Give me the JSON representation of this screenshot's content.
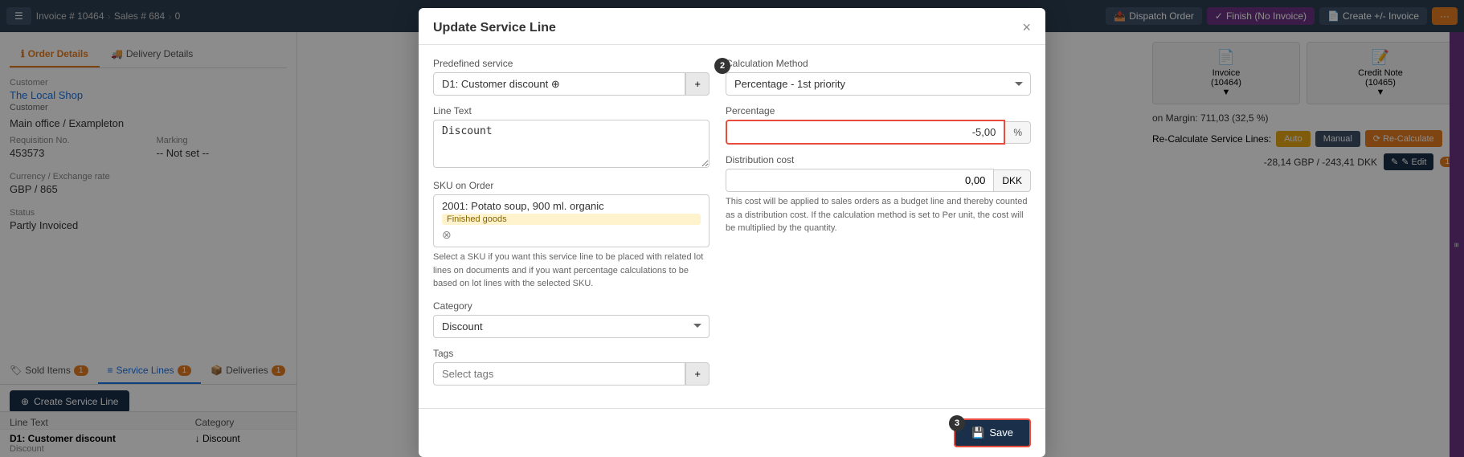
{
  "topnav": {
    "app_icon": "☰",
    "breadcrumbs": [
      {
        "label": "Invoice # 10464",
        "icon": "📄"
      },
      {
        "label": "Sales # 684",
        "icon": "📋"
      },
      {
        "label": "0",
        "icon": "🔗"
      }
    ],
    "buttons": [
      {
        "label": "Dispatch Order",
        "icon": "📤",
        "style": "dark"
      },
      {
        "label": "Finish (No Invoice)",
        "icon": "✓",
        "style": "purple"
      },
      {
        "label": "Create +/- Invoice",
        "icon": "📄",
        "style": "dark"
      },
      {
        "label": "...",
        "icon": "",
        "style": "orange"
      }
    ]
  },
  "left_panel": {
    "tabs": [
      {
        "label": "Order Details",
        "icon": "ℹ",
        "active": true
      },
      {
        "label": "Delivery Details",
        "icon": "🚚",
        "active": false
      }
    ],
    "customer_label": "Customer",
    "customer_name": "The Local Shop",
    "customer_type": "Customer",
    "address": "Main office / Exampleton",
    "fields": [
      {
        "label": "Requisition No.",
        "value": "453573"
      },
      {
        "label": "Marking",
        "value": "-- Not set --"
      },
      {
        "label": "Currency / Exchange rate",
        "value": "GBP / 865"
      },
      {
        "label": "Status",
        "value": "Partly Invoiced"
      }
    ],
    "bottom_tabs": [
      {
        "label": "Sold Items",
        "icon": "🏷",
        "badge": "1"
      },
      {
        "label": "Service Lines",
        "icon": "≡",
        "badge": "1",
        "active": true
      },
      {
        "label": "Deliveries",
        "icon": "📦",
        "badge": "1"
      }
    ],
    "create_btn": "Create Service Line",
    "table_headers": [
      "Line Text",
      "Category"
    ],
    "table_row": {
      "line_text": "D1: Customer discount",
      "sub_text": "Discount",
      "category_icon": "↓",
      "category": "Discount"
    }
  },
  "right_panel": {
    "doc_cards": [
      {
        "icon": "📄",
        "label": "Invoice",
        "sub": "(10464)",
        "arrow": "▼"
      },
      {
        "icon": "📝",
        "label": "Credit Note",
        "sub": "(10465)",
        "arrow": "▼"
      }
    ],
    "margin_text": "on Margin: 711,03 (32,5 %)",
    "recalc_label": "Re-Calculate Service Lines:",
    "recalc_btns": [
      {
        "label": "Auto",
        "style": "gold"
      },
      {
        "label": "Manual",
        "style": "dark"
      },
      {
        "label": "⟳ Re-Calculate",
        "style": "orange"
      }
    ],
    "price_text": "-28,14 GBP / -243,41 DKK",
    "edit_btn": "✎ Edit",
    "badge_num": "1"
  },
  "modal": {
    "title": "Update Service Line",
    "close_label": "×",
    "predefined_label": "Predefined service",
    "predefined_value": "D1: Customer discount",
    "predefined_placeholder": "D1: Customer discount ⊕",
    "calc_method_label": "Calculation Method",
    "calc_method_value": "Percentage - 1st priority",
    "line_text_label": "Line Text",
    "line_text_value": "Discount",
    "percentage_label": "Percentage",
    "percentage_value": "-5,00",
    "percentage_unit": "%",
    "sku_label": "SKU on Order",
    "sku_value": "2001: Potato soup, 900 ml. organic",
    "sku_tag": "Finished goods",
    "sku_help": "Select a SKU if you want this service line to be placed with related lot lines on documents and if you want percentage calculations to be based on lot lines with the selected SKU.",
    "distribution_label": "Distribution cost",
    "distribution_value": "0,00",
    "distribution_unit": "DKK",
    "distribution_help": "This cost will be applied to sales orders as a budget line and thereby counted as a distribution cost. If the calculation method is set to Per unit, the cost will be multiplied by the quantity.",
    "category_label": "Category",
    "category_value": "Discount",
    "tags_label": "Tags",
    "tags_placeholder": "Select tags",
    "save_label": "Save",
    "save_icon": "💾",
    "step_numbers": {
      "step2": "2",
      "step3": "3"
    }
  }
}
